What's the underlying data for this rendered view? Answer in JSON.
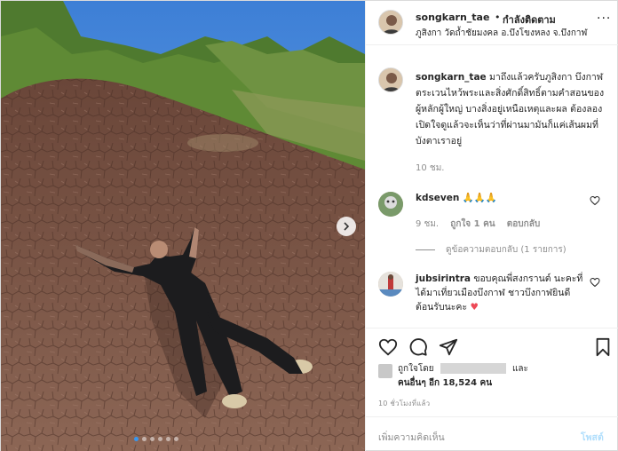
{
  "header": {
    "username": "songkarn_tae",
    "separator": "•",
    "follow_status": "กำลังติดตาม",
    "location": "ภูสิงกา วัดถ้ำชัยมงคล อ.บึงโขงหลง จ.บึงกาฬ",
    "more_icon": "more-horizontal-icon",
    "more": "···"
  },
  "caption": {
    "username": "songkarn_tae",
    "text": "มาถึงแล้วครับภูสิงกา บึงกาฬ ตระเวนไหว้พระและสิ่งศักดิ์สิทธิ์ตามคำสอนของผู้หลักผู้ใหญ่ บางสิ่งอยู่เหนือเหตุและผล ต้องลองเปิดใจดูแล้วจะเห็นว่าที่ผ่านมามันก็แค่เส้นผมที่บังตาเราอยู่",
    "time": "10 ชม."
  },
  "comments": [
    {
      "username": "kdseven",
      "text": "🙏🙏🙏",
      "time": "9 ชม.",
      "likes": "ถูกใจ 1 คน",
      "reply": "ตอบกลับ",
      "view_replies": "ดูข้อความตอบกลับ (1 รายการ)"
    },
    {
      "username": "jubsirintra",
      "text": "ขอบคุณพี่สงกรานต์ นะคะที่ ได้มาเที่ยวเมืองบึงกาฬ ชาวบึงกาฬยินดีต้อนรับนะคะ",
      "heart": "♥"
    }
  ],
  "actions": {
    "like_icon": "heart-icon",
    "comment_icon": "comment-icon",
    "share_icon": "share-icon",
    "save_icon": "bookmark-icon"
  },
  "likes": {
    "prefix": "ถูกใจโดย",
    "and": "และ",
    "others_label": "คนอื่นๆ",
    "others_count": "อีก 18,524 คน"
  },
  "post_time": "10 ชั่วโมงที่แล้ว",
  "add_comment": {
    "placeholder": "เพิ่มความคิดเห็น",
    "post": "โพสต์"
  },
  "carousel": {
    "next_icon": "chevron-right-icon",
    "slide_count": 6,
    "active_slide": 1
  }
}
